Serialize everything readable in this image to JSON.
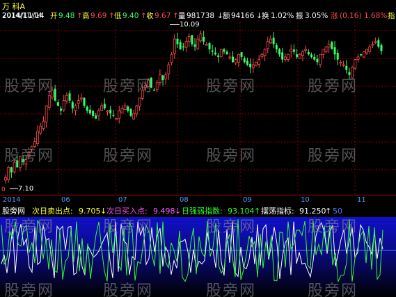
{
  "header": {
    "stock_name": "万  科A",
    "date": "2014/11/14",
    "open_label": "开",
    "open_value": "9.48",
    "high_label": "高",
    "high_value": "9.69",
    "low_label": "低",
    "low_value": "9.40",
    "close_label": "收",
    "close_value": "9.67",
    "up_arrow": "↑",
    "volume_label": "量",
    "volume_value": "981738",
    "down_arrow": "↓",
    "amount_label": "额",
    "amount_value": "94166",
    "turnover_label": "换",
    "turnover_value": "1.02%",
    "amplitude_label": "振",
    "amplitude_value": "3.05%",
    "change_label": "涨",
    "change_value": "(0.16)",
    "change_pct": "1.68%",
    "more_label": "指"
  },
  "price_markers": {
    "high_marker": "10.09",
    "low_marker": "7.10",
    "corner_marker": "0"
  },
  "time_axis": [
    "2014",
    "06",
    "07",
    "08",
    "09",
    "10",
    "11"
  ],
  "indicator_header": {
    "name": "股旁网",
    "sell_label": "次日卖出点:",
    "sell_value": "9.705",
    "buy_label": "次日买入点:",
    "buy_value": "9.498",
    "strength_label": "日强弱指数:",
    "strength_value": "93.104",
    "swing_label": "摆荡指标:",
    "swing_value": "91.250",
    "ref_value": "50",
    "down_arrow": "↓",
    "up_arrow": "↑"
  },
  "watermark": "股旁网",
  "colors": {
    "up": "#ff4a4a",
    "down": "#33ff66",
    "grid": "#8a0000",
    "axis_text": "#4f9bff",
    "indicator_line": "#ffffff",
    "indicator_line2": "#33ff33",
    "ref_line": "#4f7bff"
  },
  "chart_data": {
    "type": "candlestick",
    "price_range": [
      7.1,
      10.09
    ],
    "candles_close": [
      7.2,
      7.4,
      7.3,
      7.5,
      7.4,
      7.6,
      7.5,
      7.55,
      7.7,
      7.8,
      7.9,
      8.1,
      8.2,
      8.3,
      8.6,
      8.8,
      8.9,
      8.7,
      8.6,
      8.5,
      8.7,
      8.8,
      8.7,
      8.55,
      8.6,
      8.7,
      8.75,
      8.6,
      8.5,
      8.45,
      8.4,
      8.35,
      8.5,
      8.6,
      8.55,
      8.5,
      8.45,
      8.4,
      8.35,
      8.5,
      8.55,
      8.6,
      8.5,
      8.4,
      8.45,
      8.6,
      8.75,
      8.9,
      9.0,
      9.1,
      8.95,
      8.9,
      9.05,
      9.2,
      9.1,
      9.2,
      9.4,
      9.6,
      9.9,
      9.8,
      9.7,
      9.75,
      9.85,
      9.95,
      9.8,
      9.75,
      9.9,
      10.0,
      9.85,
      9.8,
      9.7,
      9.65,
      9.6,
      9.55,
      9.7,
      9.65,
      9.6,
      9.55,
      9.45,
      9.5,
      9.6,
      9.55,
      9.45,
      9.4,
      9.35,
      9.4,
      9.45,
      9.5,
      9.6,
      9.7,
      9.85,
      9.9,
      9.8,
      9.7,
      9.6,
      9.5,
      9.55,
      9.6,
      9.7,
      9.65,
      9.55,
      9.6,
      9.65,
      9.7,
      9.6,
      9.55,
      9.5,
      9.45,
      9.6,
      9.7,
      9.75,
      9.8,
      9.7,
      9.6,
      9.5,
      9.45,
      9.4,
      9.3,
      9.2,
      9.35,
      9.5,
      9.55,
      9.6,
      9.65,
      9.7,
      9.75,
      9.8,
      9.85,
      9.75,
      9.67
    ]
  }
}
